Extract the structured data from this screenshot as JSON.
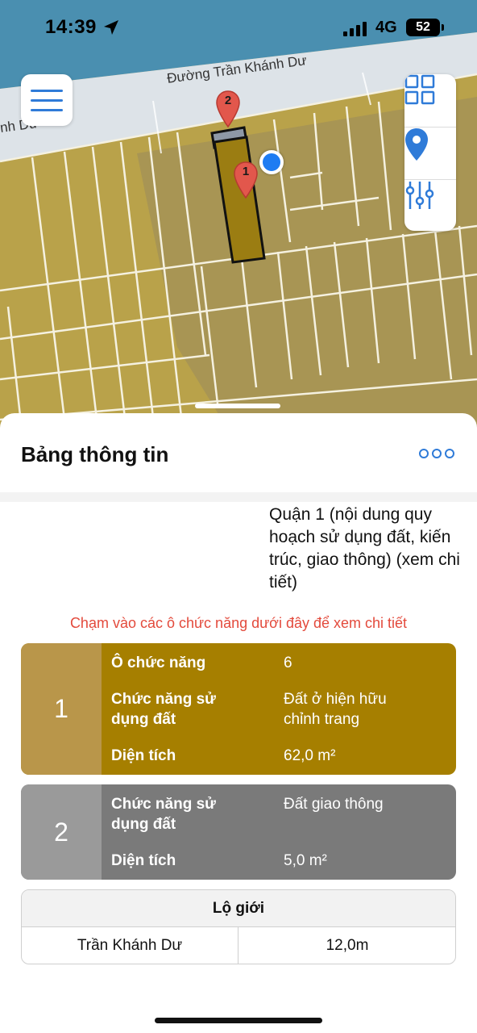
{
  "status_bar": {
    "time": "14:39",
    "network": "4G",
    "battery": "52",
    "location_icon": "location-arrow-icon",
    "signal_icon": "signal-bars-icon"
  },
  "map": {
    "road_label": "Đường Trần Khánh Dư",
    "road_label_fragment": "nh Dư",
    "pins": [
      {
        "number": "2",
        "icon": "map-pin-icon"
      },
      {
        "number": "1",
        "icon": "map-pin-icon"
      }
    ],
    "controls": {
      "menu_icon": "hamburger-menu-icon",
      "layers_icon": "grid-layers-icon",
      "location_icon": "location-pin-icon",
      "filter_icon": "sliders-icon"
    },
    "colors": {
      "water": "#4a8fb0",
      "road": "#dde3e8",
      "land": "#b9a24a",
      "parcel_highlight": "#9b7d12",
      "user_location": "#1e7cf2"
    }
  },
  "sheet": {
    "title": "Bảng thông tin",
    "more_icon": "more-dots-icon",
    "district_text": "Quận 1 (nội dung quy hoạch sử dụng đất, kiến trúc, giao thông) (xem chi tiết)",
    "hint": "Chạm vào các ô chức năng dưới đây để xem chi tiết",
    "cards": [
      {
        "index": "1",
        "color": "#a67f00",
        "rows": [
          {
            "label": "Ô chức năng",
            "value": "6"
          },
          {
            "label": "Chức năng sử dụng đất",
            "value": "Đất ở hiện hữu chỉnh trang"
          },
          {
            "label": "Diện tích",
            "value": "62,0 m²"
          }
        ]
      },
      {
        "index": "2",
        "color": "#7a7a7a",
        "rows": [
          {
            "label": "Chức năng sử dụng đất",
            "value": "Đất giao thông"
          },
          {
            "label": "Diện tích",
            "value": "5,0 m²"
          }
        ]
      }
    ],
    "road_table": {
      "header": "Lộ giới",
      "rows": [
        {
          "road": "Trần Khánh Dư",
          "width": "12,0m"
        }
      ]
    }
  }
}
